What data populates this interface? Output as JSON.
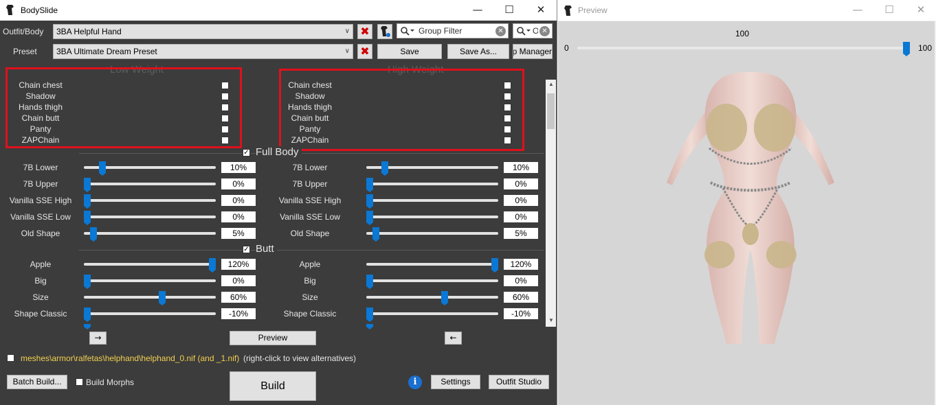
{
  "bodyslide": {
    "title": "BodySlide",
    "outfit_label": "Outfit/Body",
    "outfit_value": "3BA Helpful Hand",
    "preset_label": "Preset",
    "preset_value": "3BA Ultimate Dream Preset",
    "group_filter_placeholder": "Group Filter",
    "outfit_filter_placeholder": "Outfit Filter",
    "save": "Save",
    "save_as": "Save As...",
    "group_manager": "Group Manager",
    "low_weight": "Low Weight",
    "high_weight": "High Weight",
    "zap_items": [
      "Chain chest",
      "Shadow",
      "Hands thigh",
      "Chain butt",
      "Panty",
      "ZAPChain"
    ],
    "sections": [
      {
        "title": "Full Body",
        "checked": true,
        "sliders": [
          {
            "name": "7B Lower",
            "low": "10%",
            "high": "10%",
            "low_pos": 0.12,
            "high_pos": 0.12
          },
          {
            "name": "7B Upper",
            "low": "0%",
            "high": "0%",
            "low_pos": 0.0,
            "high_pos": 0.0
          },
          {
            "name": "Vanilla SSE High",
            "low": "0%",
            "high": "0%",
            "low_pos": 0.0,
            "high_pos": 0.0
          },
          {
            "name": "Vanilla SSE Low",
            "low": "0%",
            "high": "0%",
            "low_pos": 0.0,
            "high_pos": 0.0
          },
          {
            "name": "Old Shape",
            "low": "5%",
            "high": "5%",
            "low_pos": 0.05,
            "high_pos": 0.05
          }
        ]
      },
      {
        "title": "Butt",
        "checked": true,
        "sliders": [
          {
            "name": "Apple",
            "low": "120%",
            "high": "120%",
            "low_pos": 1.0,
            "high_pos": 1.0
          },
          {
            "name": "Big",
            "low": "0%",
            "high": "0%",
            "low_pos": 0.0,
            "high_pos": 0.0
          },
          {
            "name": "Size",
            "low": "60%",
            "high": "60%",
            "low_pos": 0.6,
            "high_pos": 0.6
          },
          {
            "name": "Shape Classic",
            "low": "-10%",
            "high": "-10%",
            "low_pos": 0.0,
            "high_pos": 0.0
          }
        ]
      }
    ],
    "arrow_right": "→",
    "arrow_left": "←",
    "preview": "Preview",
    "file_path": "meshes\\armor\\ralfetas\\helphand\\helphand_0.nif (and _1.nif)",
    "file_hint": "(right-click to view alternatives)",
    "batch_build": "Batch Build...",
    "build_morphs": "Build Morphs",
    "build": "Build",
    "info": "i",
    "settings": "Settings",
    "outfit_studio": "Outfit Studio"
  },
  "preview": {
    "title": "Preview",
    "weight_value": "100",
    "min": "0",
    "max": "100",
    "weight_pos": 1.0
  },
  "colors": {
    "accent": "#0a78d4",
    "highlight": "#e0101c",
    "panel": "#3c3c3c"
  }
}
